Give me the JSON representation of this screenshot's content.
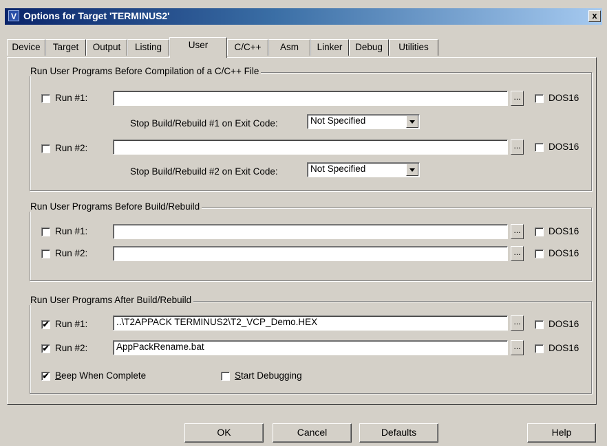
{
  "window": {
    "title": "Options for Target 'TERMINUS2'",
    "icon": "V",
    "close": "x"
  },
  "tabs": [
    "Device",
    "Target",
    "Output",
    "Listing",
    "User",
    "C/C++",
    "Asm",
    "Linker",
    "Debug",
    "Utilities"
  ],
  "active_tab": "User",
  "groups": {
    "before_compile": {
      "title": "Run User Programs Before Compilation of a C/C++ File",
      "run1": {
        "label": "Run #1:",
        "checked": false,
        "value": "",
        "dos16": "DOS16",
        "dos16_checked": false
      },
      "stop1": {
        "label": "Stop Build/Rebuild #1 on Exit Code:",
        "value": "Not Specified"
      },
      "run2": {
        "label": "Run #2:",
        "checked": false,
        "value": "",
        "dos16": "DOS16",
        "dos16_checked": false
      },
      "stop2": {
        "label": "Stop Build/Rebuild #2 on Exit Code:",
        "value": "Not Specified"
      }
    },
    "before_build": {
      "title": "Run User Programs Before Build/Rebuild",
      "run1": {
        "label": "Run #1:",
        "checked": false,
        "value": "",
        "dos16": "DOS16",
        "dos16_checked": false
      },
      "run2": {
        "label": "Run #2:",
        "checked": false,
        "value": "",
        "dos16": "DOS16",
        "dos16_checked": false
      }
    },
    "after_build": {
      "title": "Run User Programs After Build/Rebuild",
      "run1": {
        "label": "Run #1:",
        "checked": true,
        "value": "..\\T2APPACK TERMINUS2\\T2_VCP_Demo.HEX",
        "dos16": "DOS16",
        "dos16_checked": false
      },
      "run2": {
        "label": "Run #2:",
        "checked": true,
        "value": "AppPackRename.bat",
        "dos16": "DOS16",
        "dos16_checked": false
      },
      "beep": {
        "label_first": "B",
        "label_rest": "eep When Complete",
        "checked": true
      },
      "debug": {
        "label_first": "S",
        "label_rest": "tart Debugging",
        "checked": false
      }
    }
  },
  "browse_label": "...",
  "check_mark": "✔",
  "buttons": {
    "ok": "OK",
    "cancel": "Cancel",
    "defaults": "Defaults",
    "help": "Help"
  }
}
